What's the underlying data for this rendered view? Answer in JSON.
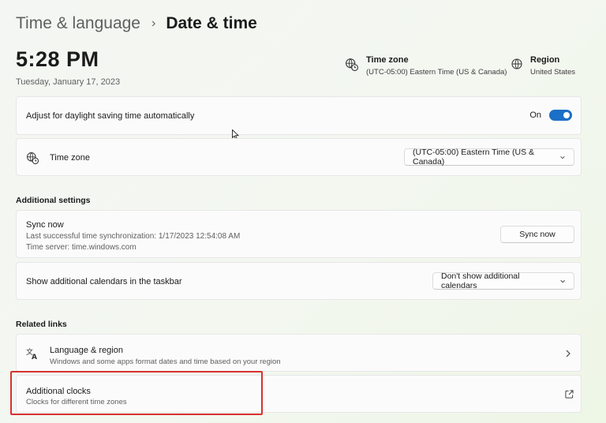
{
  "breadcrumb": {
    "parent": "Time & language",
    "separator": "›",
    "current": "Date & time"
  },
  "clock": {
    "time": "5:28 PM",
    "date": "Tuesday, January 17, 2023"
  },
  "header_info": {
    "timezone": {
      "title": "Time zone",
      "value": "(UTC-05:00) Eastern Time (US & Canada)",
      "icon": "globe-clock-icon"
    },
    "region": {
      "title": "Region",
      "value": "United States",
      "icon": "globe-icon"
    }
  },
  "daylight": {
    "label": "Adjust for daylight saving time automatically",
    "state_text": "On",
    "enabled": true
  },
  "timezone_setting": {
    "label": "Time zone",
    "selected": "(UTC-05:00) Eastern Time (US & Canada)",
    "icon": "globe-clock-icon"
  },
  "additional_settings": {
    "title": "Additional settings",
    "sync": {
      "label": "Sync now",
      "last_sync": "Last successful time synchronization: 1/17/2023 12:54:08 AM",
      "server": "Time server: time.windows.com",
      "button_label": "Sync now"
    },
    "calendars": {
      "label": "Show additional calendars in the taskbar",
      "selected": "Don't show additional calendars"
    }
  },
  "related_links": {
    "title": "Related links",
    "language_region": {
      "title": "Language & region",
      "subtitle": "Windows and some apps format dates and time based on your region",
      "icon": "language-icon"
    },
    "additional_clocks": {
      "title": "Additional clocks",
      "subtitle": "Clocks for different time zones",
      "icon": "open-external-icon"
    }
  },
  "colors": {
    "accent": "#1a6fc6",
    "highlight_box": "#d8312f"
  }
}
